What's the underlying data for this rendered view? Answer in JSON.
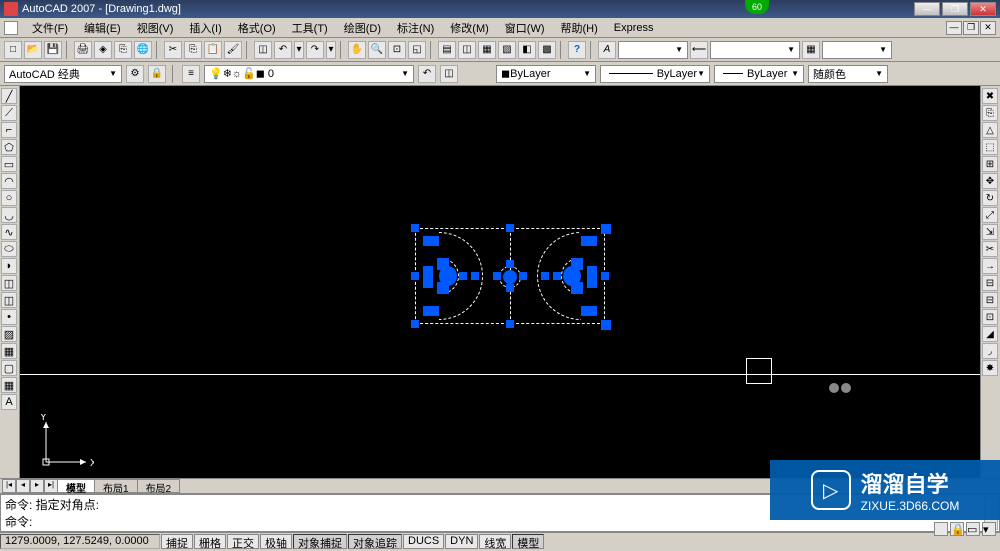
{
  "titlebar": {
    "app_name": "AutoCAD 2007",
    "doc_name": "[Drawing1.dwg]",
    "green_badge": "60"
  },
  "menu": {
    "file": "文件(F)",
    "edit": "编辑(E)",
    "view": "视图(V)",
    "insert": "插入(I)",
    "format": "格式(O)",
    "tools": "工具(T)",
    "draw": "绘图(D)",
    "dimension": "标注(N)",
    "modify": "修改(M)",
    "window": "窗口(W)",
    "help": "帮助(H)",
    "express": "Express"
  },
  "workspace": {
    "label": "AutoCAD 经典"
  },
  "properties": {
    "layer_color": "ByLayer",
    "linetype": "ByLayer",
    "lineweight": "ByLayer",
    "color_combo": "随颜色"
  },
  "tabs": {
    "model": "模型",
    "layout1": "布局1",
    "layout2": "布局2"
  },
  "ucs": {
    "x": "X",
    "y": "Y"
  },
  "command": {
    "line1": "命令: 指定对角点:",
    "line2": "命令:"
  },
  "status": {
    "coords": "1279.0009, 127.5249, 0.0000",
    "snap": "捕捉",
    "grid": "栅格",
    "ortho": "正交",
    "polar": "极轴",
    "osnap": "对象捕捉",
    "otrack": "对象追踪",
    "ducs": "DUCS",
    "dyn": "DYN",
    "lwt": "线宽",
    "model": "模型"
  },
  "watermark": {
    "brand": "溜溜自学",
    "url": "ZIXUE.3D66.COM"
  },
  "icons": {
    "new": "□",
    "open": "📂",
    "save": "💾",
    "print": "🖨",
    "plot": "◈",
    "cut": "✂",
    "copy": "⎘",
    "paste": "📋",
    "match": "🖌",
    "undo": "↶",
    "redo": "↷",
    "pan": "✋",
    "zoom": "🔍",
    "zoomw": "⊡",
    "zoomp": "◱",
    "props": "▤",
    "dc": "◫",
    "tp": "▦",
    "sheet": "▧",
    "calc": "▩",
    "help": "?",
    "line": "╱",
    "cline": "⟋",
    "pline": "⌐",
    "poly": "⬠",
    "rect": "▭",
    "arc": "◠",
    "circle": "○",
    "revc": "◡",
    "spline": "∿",
    "ellipse": "⬭",
    "earc": "◗",
    "block": "◫",
    "point": "•",
    "hatch": "▨",
    "grad": "▦",
    "region": "▢",
    "table": "▦",
    "text": "A",
    "erase": "✖",
    "copy2": "⎘",
    "mirror": "△",
    "offset": "⬚",
    "array": "⊞",
    "move": "✥",
    "rotate": "↻",
    "scale": "⤢",
    "stretch": "⇲",
    "trim": "✂",
    "extend": "→",
    "break": "⊟",
    "join": "⊡",
    "chamfer": "◢",
    "fillet": "◞",
    "explode": "✸"
  }
}
